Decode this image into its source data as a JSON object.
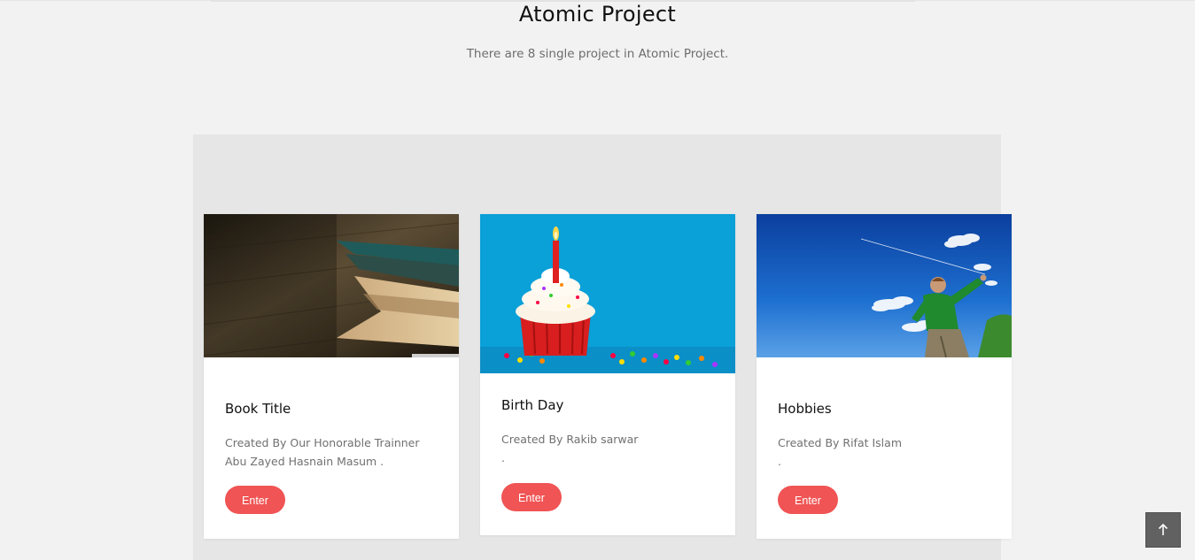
{
  "header": {
    "title": "Atomic Project",
    "subtitle": "There are 8 single project in Atomic Project."
  },
  "cards": [
    {
      "title": "Book Title",
      "desc_line1": "Created By Our Honorable Trainner",
      "desc_line2": "Abu Zayed Hasnain Masum .",
      "button": "Enter",
      "image": "book-pages-photo"
    },
    {
      "title": "Birth Day",
      "desc_line1": "Created By Rakib sarwar",
      "desc_line2": ".",
      "button": "Enter",
      "image": "birthday-cupcake-photo"
    },
    {
      "title": "Hobbies",
      "desc_line1": "Created By Rifat Islam",
      "desc_line2": ".",
      "button": "Enter",
      "image": "kid-flying-kite-photo"
    }
  ],
  "back_to_top": {
    "icon": "arrow-up-icon"
  },
  "colors": {
    "accent": "#f05454",
    "page_bg": "#f2f2f2",
    "panel_bg": "#e6e6e6",
    "back_to_top_bg": "#616161"
  }
}
